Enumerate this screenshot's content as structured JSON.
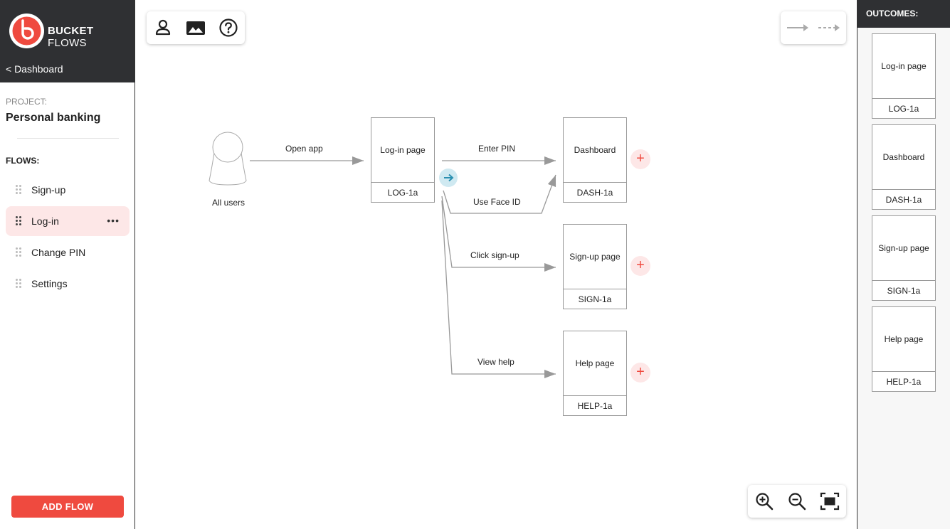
{
  "brand": {
    "name_bold": "BUCKET",
    "name_light": "FLOWS",
    "accent": "#ef4a3f",
    "dark": "#2f3033"
  },
  "sidebar": {
    "back_label": "< Dashboard",
    "project_label": "PROJECT:",
    "project_name": "Personal banking",
    "flows_label": "FLOWS:",
    "flows": [
      {
        "label": "Sign-up",
        "active": false
      },
      {
        "label": "Log-in",
        "active": true,
        "more": "•••"
      },
      {
        "label": "Change PIN",
        "active": false
      },
      {
        "label": "Settings",
        "active": false
      }
    ],
    "add_flow_label": "ADD FLOW"
  },
  "toolbar": {
    "icons": [
      "user-icon",
      "image-icon",
      "help-icon"
    ]
  },
  "connector_toolbar": {
    "icons": [
      "solid-arrow-icon",
      "dashed-arrow-icon"
    ]
  },
  "zoom_toolbar": {
    "icons": [
      "zoom-in-icon",
      "zoom-out-icon",
      "fit-screen-icon"
    ]
  },
  "diagram": {
    "start": {
      "label": "All users"
    },
    "edges": {
      "open_app": "Open app",
      "enter_pin": "Enter PIN",
      "use_face_id": "Use Face ID",
      "click_signup": "Click sign-up",
      "view_help": "View help"
    },
    "nodes": {
      "login": {
        "title": "Log-in page",
        "code": "LOG-1a"
      },
      "dashboard": {
        "title": "Dashboard",
        "code": "DASH-1a"
      },
      "signup": {
        "title": "Sign-up page",
        "code": "SIGN-1a"
      },
      "help": {
        "title": "Help page",
        "code": "HELP-1a"
      }
    },
    "plus": "+"
  },
  "outcomes": {
    "header": "OUTCOMES:",
    "items": [
      {
        "title": "Log-in page",
        "code": "LOG-1a"
      },
      {
        "title": "Dashboard",
        "code": "DASH-1a"
      },
      {
        "title": "Sign-up page",
        "code": "SIGN-1a"
      },
      {
        "title": "Help page",
        "code": "HELP-1a"
      }
    ]
  }
}
